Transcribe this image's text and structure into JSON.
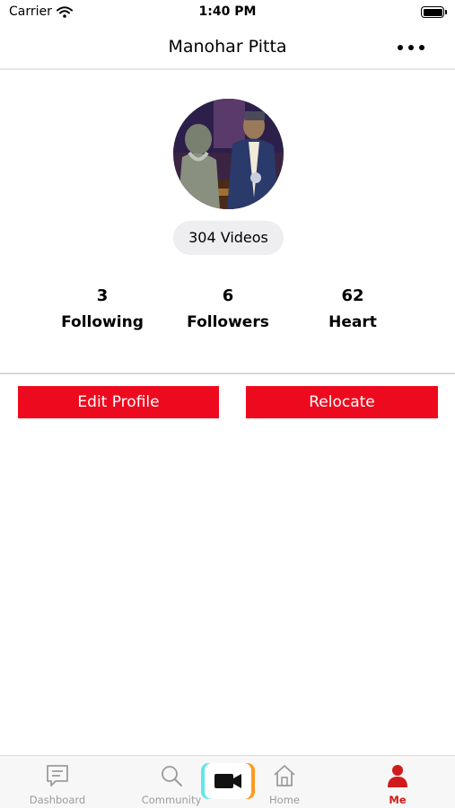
{
  "status_bar": {
    "carrier": "Carrier",
    "time": "1:40 PM"
  },
  "nav": {
    "title": "Manohar Pitta",
    "more_icon": "ellipsis-icon"
  },
  "profile": {
    "videos_label": "304 Videos",
    "stats": [
      {
        "value": "3",
        "label": "Following"
      },
      {
        "value": "6",
        "label": "Followers"
      },
      {
        "value": "62",
        "label": "Heart"
      }
    ]
  },
  "actions": {
    "edit_profile": "Edit Profile",
    "relocate": "Relocate"
  },
  "tab_bar": {
    "tabs": [
      {
        "label": "Dashboard",
        "icon": "chat-bubble-icon"
      },
      {
        "label": "Community",
        "icon": "search-icon"
      },
      {
        "label": "Home",
        "icon": "home-icon"
      },
      {
        "label": "Me",
        "icon": "person-icon"
      }
    ],
    "record_icon": "video-camera-icon",
    "active_tab": "Me"
  },
  "colors": {
    "accent": "#ee0a1e",
    "active_tab": "#d11a1a",
    "inactive_tab": "#9c9c9c"
  }
}
